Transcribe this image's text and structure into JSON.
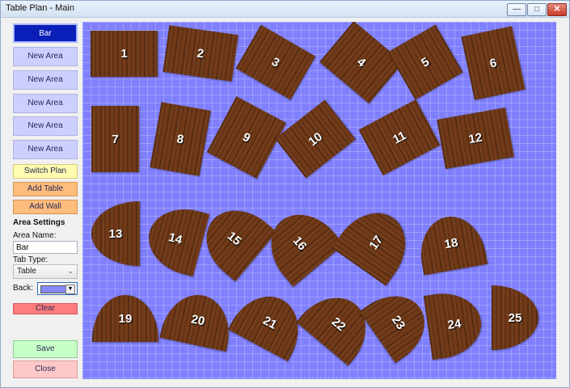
{
  "window": {
    "title": "Table Plan - Main",
    "min_glyph": "—",
    "max_glyph": "□",
    "close_glyph": "✕"
  },
  "sidebar": {
    "bar_label": "Bar",
    "area_buttons": [
      "New Area",
      "New Area",
      "New Area",
      "New Area",
      "New Area"
    ],
    "switch_plan": "Switch Plan",
    "add_table": "Add Table",
    "add_wall": "Add Wall",
    "settings_heading": "Area Settings",
    "area_name_label": "Area Name:",
    "area_name_value": "Bar",
    "tab_type_label": "Tab Type:",
    "tab_type_value": "Table",
    "back_label": "Back:",
    "back_color": "#8888ff",
    "clear": "Clear",
    "save": "Save",
    "close": "Close"
  },
  "canvas": {
    "background": "#8080fe"
  },
  "tables": [
    "1",
    "2",
    "3",
    "4",
    "5",
    "6",
    "7",
    "8",
    "9",
    "10",
    "11",
    "12",
    "13",
    "14",
    "15",
    "16",
    "17",
    "18",
    "19",
    "20",
    "21",
    "22",
    "23",
    "24",
    "25"
  ]
}
